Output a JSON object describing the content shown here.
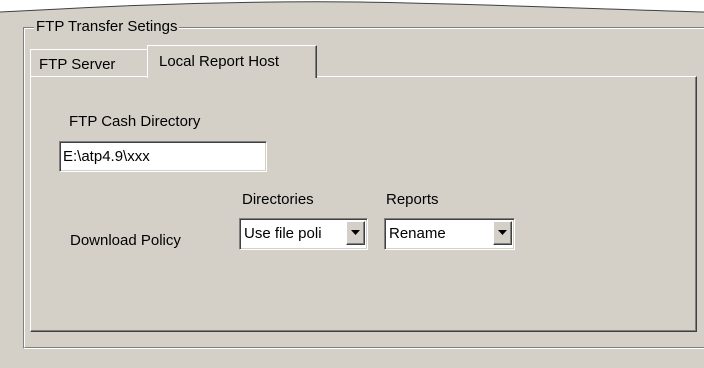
{
  "group_title": "FTP Transfer Setings",
  "tabs": [
    {
      "label": "FTP Server",
      "active": false
    },
    {
      "label": "Local Report Host",
      "active": true
    }
  ],
  "cash_directory": {
    "label": "FTP Cash Directory",
    "value": "E:\\atp4.9\\xxx"
  },
  "download_policy": {
    "label": "Download Policy",
    "directories": {
      "label": "Directories",
      "selected": "Use file poli",
      "icon": "chevron-down-icon"
    },
    "reports": {
      "label": "Reports",
      "selected": "Rename",
      "icon": "chevron-down-icon"
    }
  }
}
